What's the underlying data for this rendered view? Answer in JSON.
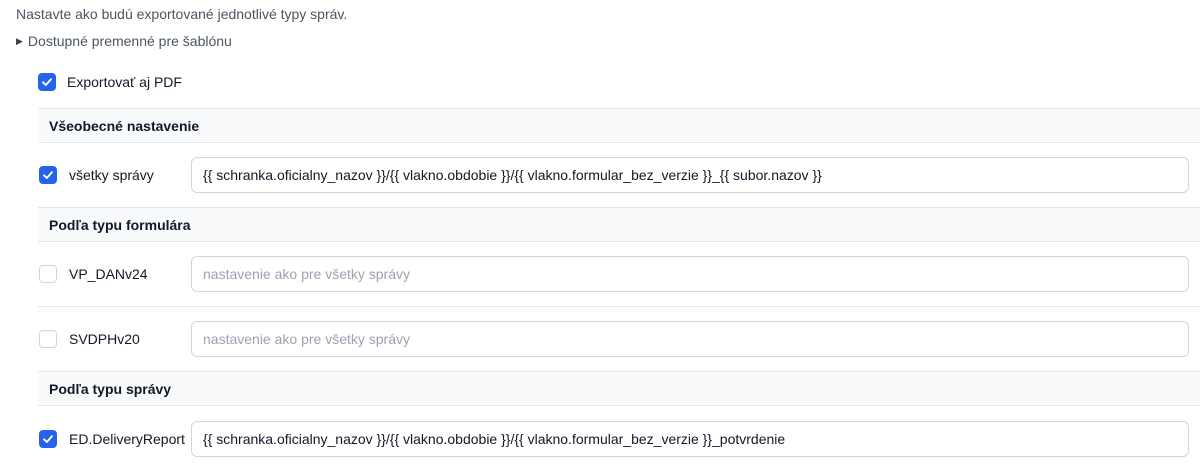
{
  "intro": "Nastavte ako budú exportované jednotlivé typy správ.",
  "variables_toggle": "Dostupné premenné pre šablónu",
  "export_pdf": {
    "label": "Exportovať aj PDF",
    "checked": true
  },
  "sections": {
    "general": {
      "title": "Všeobecné nastavenie",
      "rows": [
        {
          "name": "všetky správy",
          "checked": true,
          "value": "{{ schranka.oficialny_nazov }}/{{ vlakno.obdobie }}/{{ vlakno.formular_bez_verzie }}_{{ subor.nazov }}",
          "placeholder": ""
        }
      ]
    },
    "by_form": {
      "title": "Podľa typu formulára",
      "rows": [
        {
          "name": "VP_DANv24",
          "checked": false,
          "value": "",
          "placeholder": "nastavenie ako pre všetky správy"
        },
        {
          "name": "SVDPHv20",
          "checked": false,
          "value": "",
          "placeholder": "nastavenie ako pre všetky správy"
        }
      ]
    },
    "by_message": {
      "title": "Podľa typu správy",
      "rows": [
        {
          "name": "ED.DeliveryReport",
          "checked": true,
          "value": "{{ schranka.oficialny_nazov }}/{{ vlakno.obdobie }}/{{ vlakno.formular_bez_verzie }}_potvrdenie",
          "placeholder": ""
        }
      ]
    }
  },
  "colors": {
    "accent": "#2563eb",
    "section_bg": "#f9fafb",
    "border": "#e5e7eb"
  }
}
